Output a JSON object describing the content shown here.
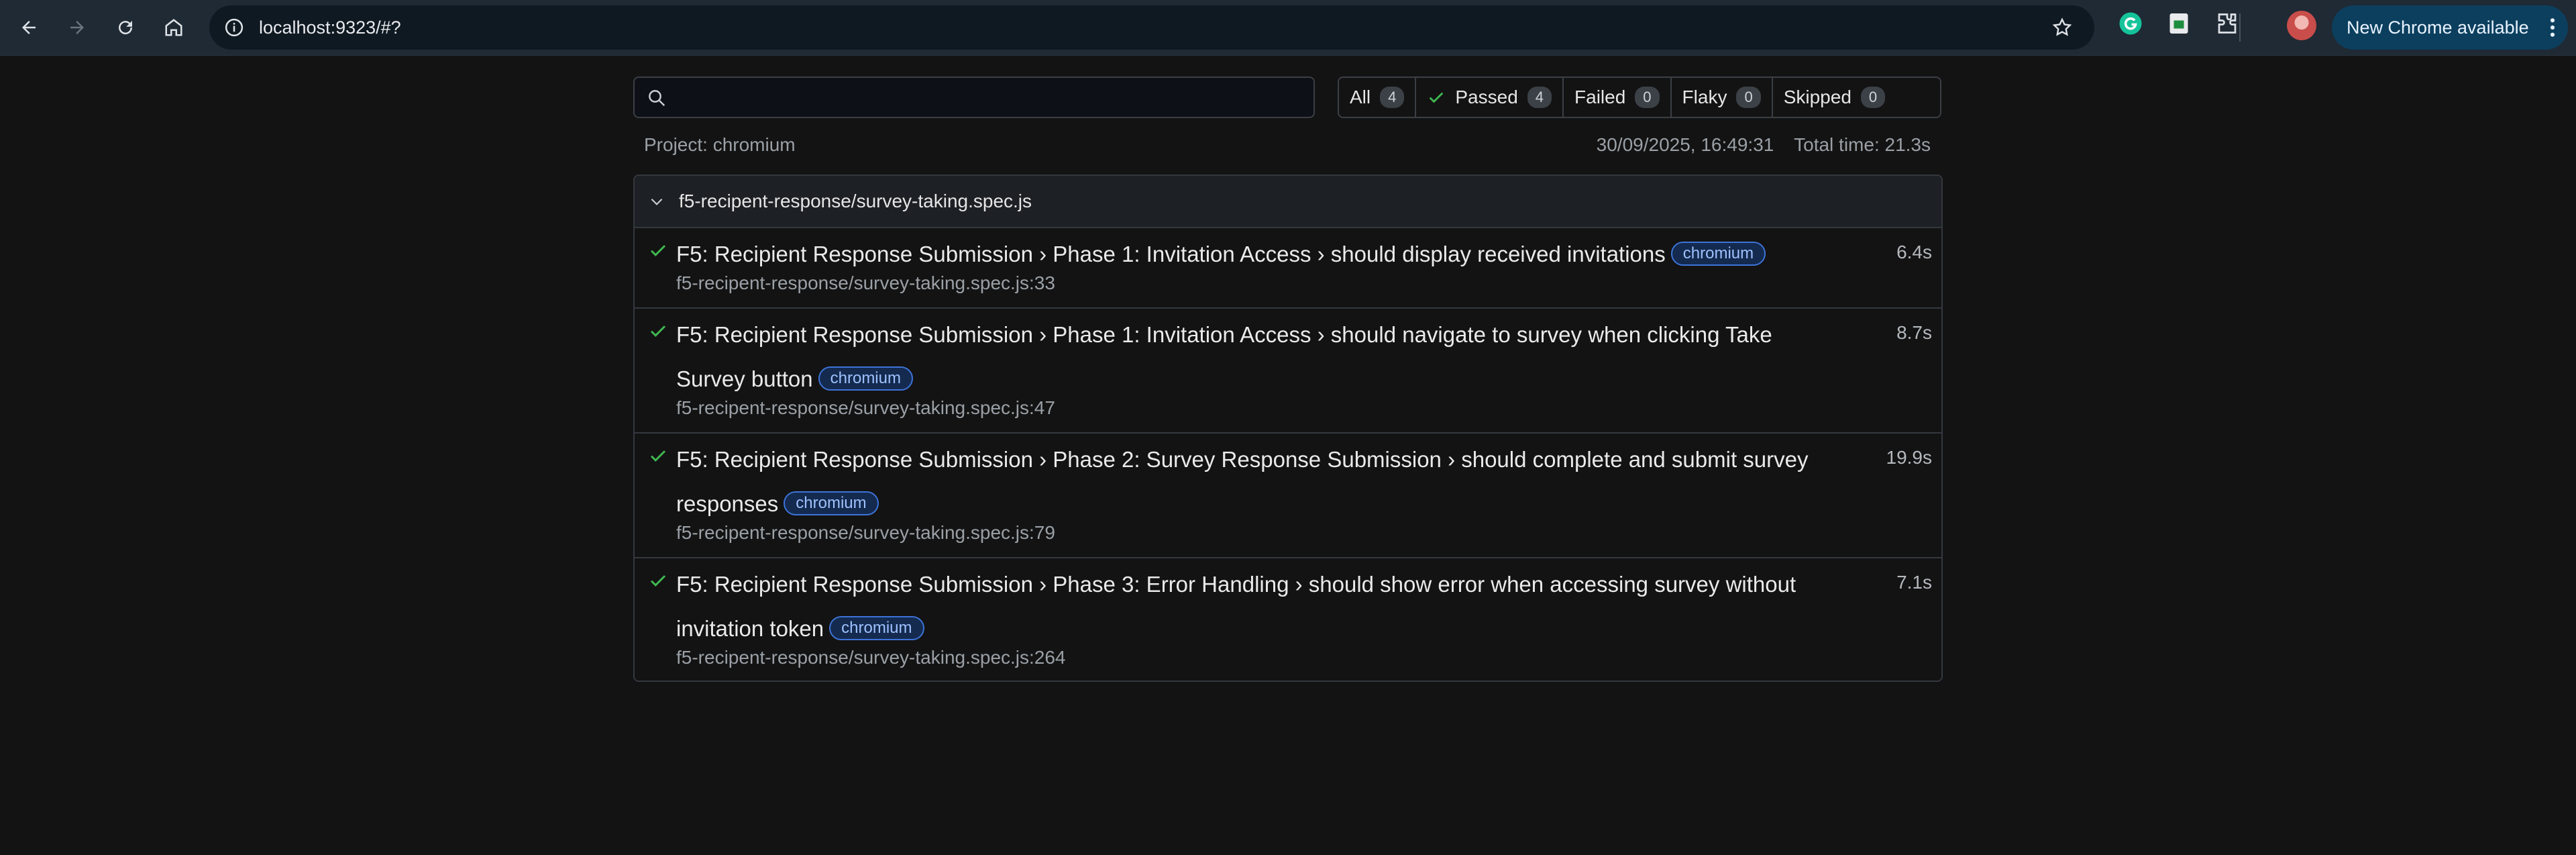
{
  "browser": {
    "url": "localhost:9323/#?",
    "update_label": "New Chrome available"
  },
  "report": {
    "search": {
      "value": "",
      "placeholder": ""
    },
    "filters": [
      {
        "label": "All",
        "count": "4"
      },
      {
        "label": "Passed",
        "count": "4"
      },
      {
        "label": "Failed",
        "count": "0"
      },
      {
        "label": "Flaky",
        "count": "0"
      },
      {
        "label": "Skipped",
        "count": "0"
      }
    ],
    "project": "Project: chromium",
    "timestamp": "30/09/2025, 16:49:31",
    "total_time": "Total time: 21.3s",
    "file": "f5-recipent-response/survey-taking.spec.js",
    "tests": [
      {
        "title": "F5: Recipient Response Submission › Phase 1: Invitation Access › should display received invitations",
        "project": "chromium",
        "duration": "6.4s",
        "location": "f5-recipent-response/survey-taking.spec.js:33",
        "status": "passed"
      },
      {
        "title": "F5: Recipient Response Submission › Phase 1: Invitation Access › should navigate to survey when clicking Take Survey button",
        "project": "chromium",
        "duration": "8.7s",
        "location": "f5-recipent-response/survey-taking.spec.js:47",
        "status": "passed"
      },
      {
        "title": "F5: Recipient Response Submission › Phase 2: Survey Response Submission › should complete and submit survey responses",
        "project": "chromium",
        "duration": "19.9s",
        "location": "f5-recipent-response/survey-taking.spec.js:79",
        "status": "passed"
      },
      {
        "title": "F5: Recipient Response Submission › Phase 3: Error Handling › should show error when accessing survey without invitation token",
        "project": "chromium",
        "duration": "7.1s",
        "location": "f5-recipent-response/survey-taking.spec.js:264",
        "status": "passed"
      }
    ]
  },
  "colors": {
    "passed": "#3fb950",
    "badge_border": "#3d74d9",
    "background": "#131313"
  }
}
